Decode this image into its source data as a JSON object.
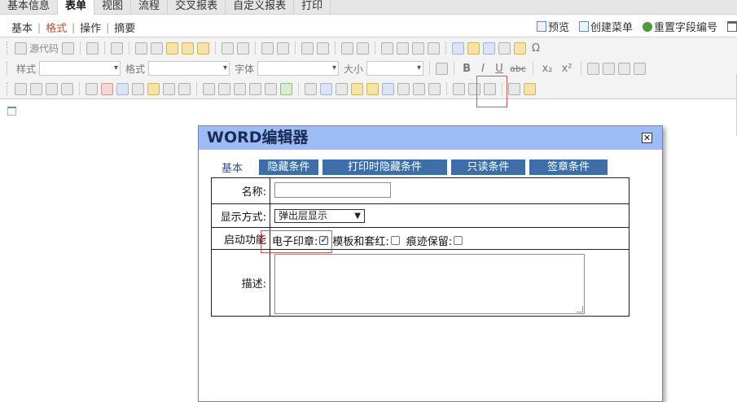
{
  "top_tabs": [
    "基本信息",
    "表单",
    "视图",
    "流程",
    "交叉报表",
    "自定义报表",
    "打印"
  ],
  "top_tab_active": 1,
  "sub_tabs": [
    "基本",
    "格式",
    "操作",
    "摘要"
  ],
  "sub_tab_active": 1,
  "actions": {
    "preview": "预览",
    "create_menu": "创建菜单",
    "reset_field": "重置字段编号"
  },
  "toolbar": {
    "source": "源代码",
    "style_label": "样式",
    "format_label": "格式",
    "font_label": "字体",
    "size_label": "大小",
    "bold": "B",
    "italic": "I",
    "underline": "U",
    "strike": "abc",
    "sub": "x₂",
    "sup": "x²"
  },
  "dialog": {
    "title": "WORD编辑器",
    "close": "✕",
    "tab_basic": "基本",
    "tabs": [
      "隐藏条件",
      "打印时隐藏条件",
      "只读条件",
      "签章条件"
    ],
    "fields": {
      "name_label": "名称:",
      "name_value": "",
      "display_label": "显示方式:",
      "display_value": "弹出层显示",
      "func_label": "启动功能",
      "seal_label": "电子印章:",
      "seal_checked": true,
      "template_label": "模板和套红:",
      "template_checked": false,
      "trace_label": "痕迹保留:",
      "trace_checked": false,
      "desc_label": "描述:",
      "desc_value": ""
    }
  }
}
